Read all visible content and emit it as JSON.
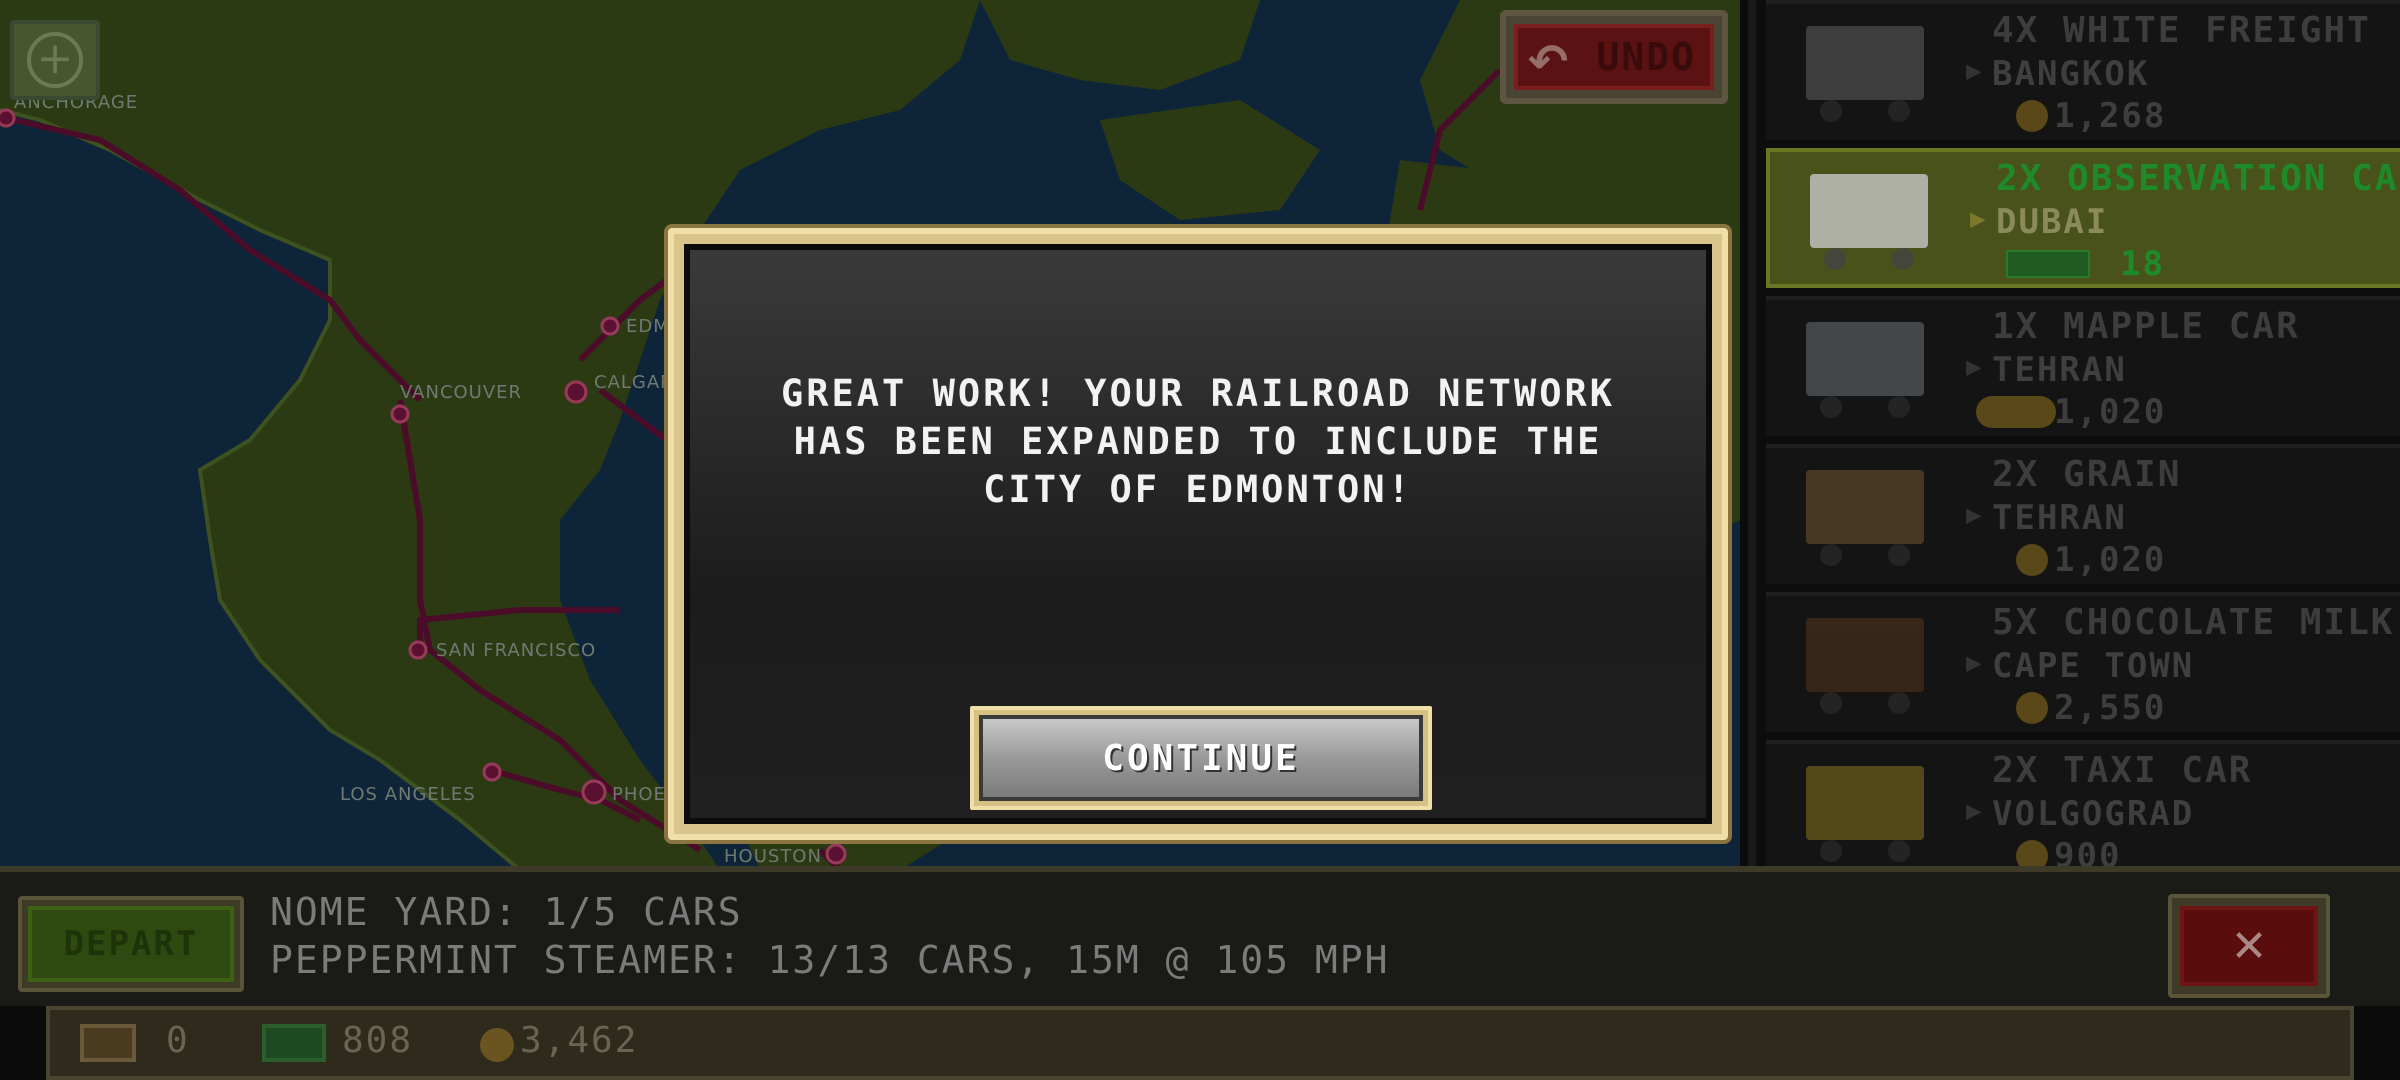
{
  "map": {
    "cities": [
      "ANCHORAGE",
      "EDM",
      "VANCOUVER",
      "CALGAR",
      "SAN FRANCISCO",
      "LOS ANGELES",
      "PHOE",
      "HOUSTON"
    ]
  },
  "undo_label": "UNDO",
  "cargo": [
    {
      "qty": "4X WHITE FREIGHT",
      "dest": "BANGKOK",
      "pay": "1,268",
      "color": "#8a8a8a"
    },
    {
      "qty": "2X OBSERVATION CA",
      "dest": "DUBAI",
      "pay": "18",
      "color": "#c8c8c8",
      "selected": true
    },
    {
      "qty": "1X MAPPLE CAR",
      "dest": "TEHRAN",
      "pay": "1,020",
      "color": "#9aa6b0"
    },
    {
      "qty": "2X GRAIN",
      "dest": "TEHRAN",
      "pay": "1,020",
      "color": "#a87a3a"
    },
    {
      "qty": "5X CHOCOLATE MILK",
      "dest": "CAPE TOWN",
      "pay": "2,550",
      "color": "#7a4a22"
    },
    {
      "qty": "2X TAXI CAR",
      "dest": "VOLGOGRAD",
      "pay": "900",
      "color": "#c8a822"
    }
  ],
  "bottom": {
    "depart_label": "DEPART",
    "yard_status": "NOME YARD: 1/5 CARS",
    "train_status": "PEPPERMINT STEAMER: 13/13 CARS, 15M @ 105 MPH",
    "close_label": "✕"
  },
  "resources": {
    "cars": "0",
    "cash": "808",
    "coins": "3,462"
  },
  "modal": {
    "message": "GREAT WORK! YOUR RAILROAD NETWORK HAS BEEN EXPANDED TO INCLUDE THE CITY OF EDMONTON!",
    "continue_label": "CONTINUE"
  }
}
